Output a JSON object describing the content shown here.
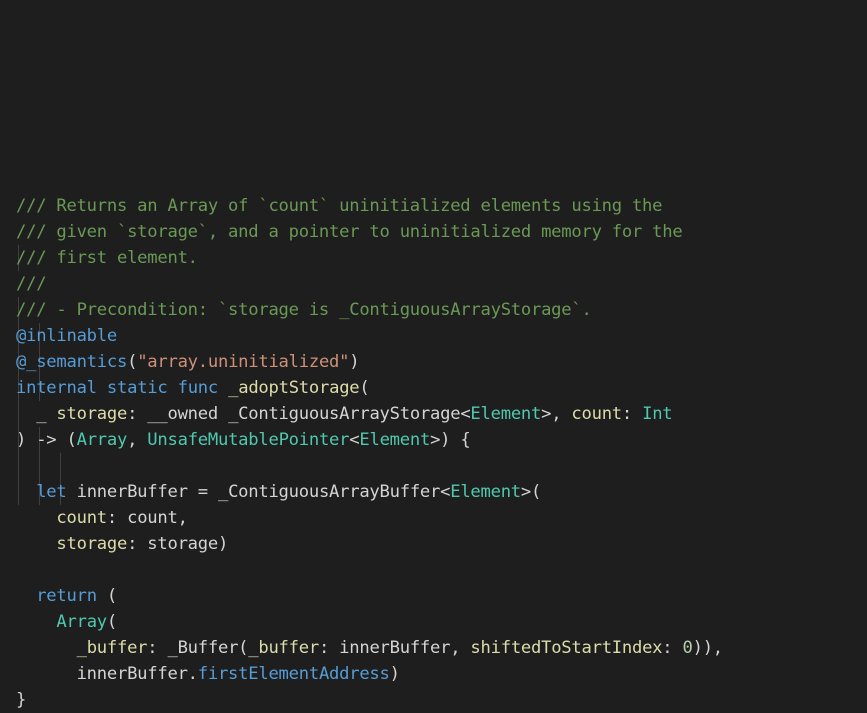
{
  "editor": {
    "lines": [
      [
        {
          "t": "/// Returns an Array of `count` uninitialized elements using the",
          "c": "comment"
        }
      ],
      [
        {
          "t": "/// given `storage`, and a pointer to uninitialized memory for the",
          "c": "comment"
        }
      ],
      [
        {
          "t": "/// first element.",
          "c": "comment"
        }
      ],
      [
        {
          "t": "///",
          "c": "comment"
        }
      ],
      [
        {
          "t": "/// - Precondition: `storage is _ContiguousArrayStorage`.",
          "c": "comment"
        }
      ],
      [
        {
          "t": "@inlinable",
          "c": "attr"
        }
      ],
      [
        {
          "t": "@_semantics",
          "c": "attr"
        },
        {
          "t": "(",
          "c": "plain"
        },
        {
          "t": "\"array.uninitialized\"",
          "c": "string"
        },
        {
          "t": ")",
          "c": "plain"
        }
      ],
      [
        {
          "t": "internal",
          "c": "keyword"
        },
        {
          "t": " ",
          "c": "plain"
        },
        {
          "t": "static",
          "c": "keyword"
        },
        {
          "t": " ",
          "c": "plain"
        },
        {
          "t": "func",
          "c": "keyword"
        },
        {
          "t": " ",
          "c": "plain"
        },
        {
          "t": "_adoptStorage",
          "c": "func"
        },
        {
          "t": "(",
          "c": "plain"
        }
      ],
      [
        {
          "t": "  _ ",
          "c": "plain"
        },
        {
          "t": "storage",
          "c": "param"
        },
        {
          "t": ": __owned _ContiguousArrayStorage<",
          "c": "plain"
        },
        {
          "t": "Element",
          "c": "type"
        },
        {
          "t": ">, ",
          "c": "plain"
        },
        {
          "t": "count",
          "c": "param"
        },
        {
          "t": ": ",
          "c": "plain"
        },
        {
          "t": "Int",
          "c": "type"
        }
      ],
      [
        {
          "t": ") -> (",
          "c": "plain"
        },
        {
          "t": "Array",
          "c": "type"
        },
        {
          "t": ", ",
          "c": "plain"
        },
        {
          "t": "UnsafeMutablePointer",
          "c": "type"
        },
        {
          "t": "<",
          "c": "plain"
        },
        {
          "t": "Element",
          "c": "type"
        },
        {
          "t": ">) {",
          "c": "plain"
        }
      ],
      [],
      [
        {
          "t": "  ",
          "c": "plain"
        },
        {
          "t": "let",
          "c": "keyword"
        },
        {
          "t": " innerBuffer = _ContiguousArrayBuffer<",
          "c": "plain"
        },
        {
          "t": "Element",
          "c": "type"
        },
        {
          "t": ">(",
          "c": "plain"
        }
      ],
      [
        {
          "t": "    ",
          "c": "plain"
        },
        {
          "t": "count",
          "c": "param"
        },
        {
          "t": ": count,",
          "c": "plain"
        }
      ],
      [
        {
          "t": "    ",
          "c": "plain"
        },
        {
          "t": "storage",
          "c": "param"
        },
        {
          "t": ": storage)",
          "c": "plain"
        }
      ],
      [],
      [
        {
          "t": "  ",
          "c": "plain"
        },
        {
          "t": "return",
          "c": "keyword"
        },
        {
          "t": " (",
          "c": "plain"
        }
      ],
      [
        {
          "t": "    ",
          "c": "plain"
        },
        {
          "t": "Array",
          "c": "type"
        },
        {
          "t": "(",
          "c": "plain"
        }
      ],
      [
        {
          "t": "      ",
          "c": "plain"
        },
        {
          "t": "_buffer",
          "c": "param"
        },
        {
          "t": ": _Buffer(",
          "c": "plain"
        },
        {
          "t": "_buffer",
          "c": "param"
        },
        {
          "t": ": innerBuffer, ",
          "c": "plain"
        },
        {
          "t": "shiftedToStartIndex",
          "c": "param"
        },
        {
          "t": ": ",
          "c": "plain"
        },
        {
          "t": "0",
          "c": "number"
        },
        {
          "t": ")),",
          "c": "plain"
        }
      ],
      [
        {
          "t": "      innerBuffer.",
          "c": "plain"
        },
        {
          "t": "firstElementAddress",
          "c": "prop"
        },
        {
          "t": ")",
          "c": "plain"
        }
      ],
      [
        {
          "t": "}",
          "c": "plain"
        }
      ]
    ]
  }
}
